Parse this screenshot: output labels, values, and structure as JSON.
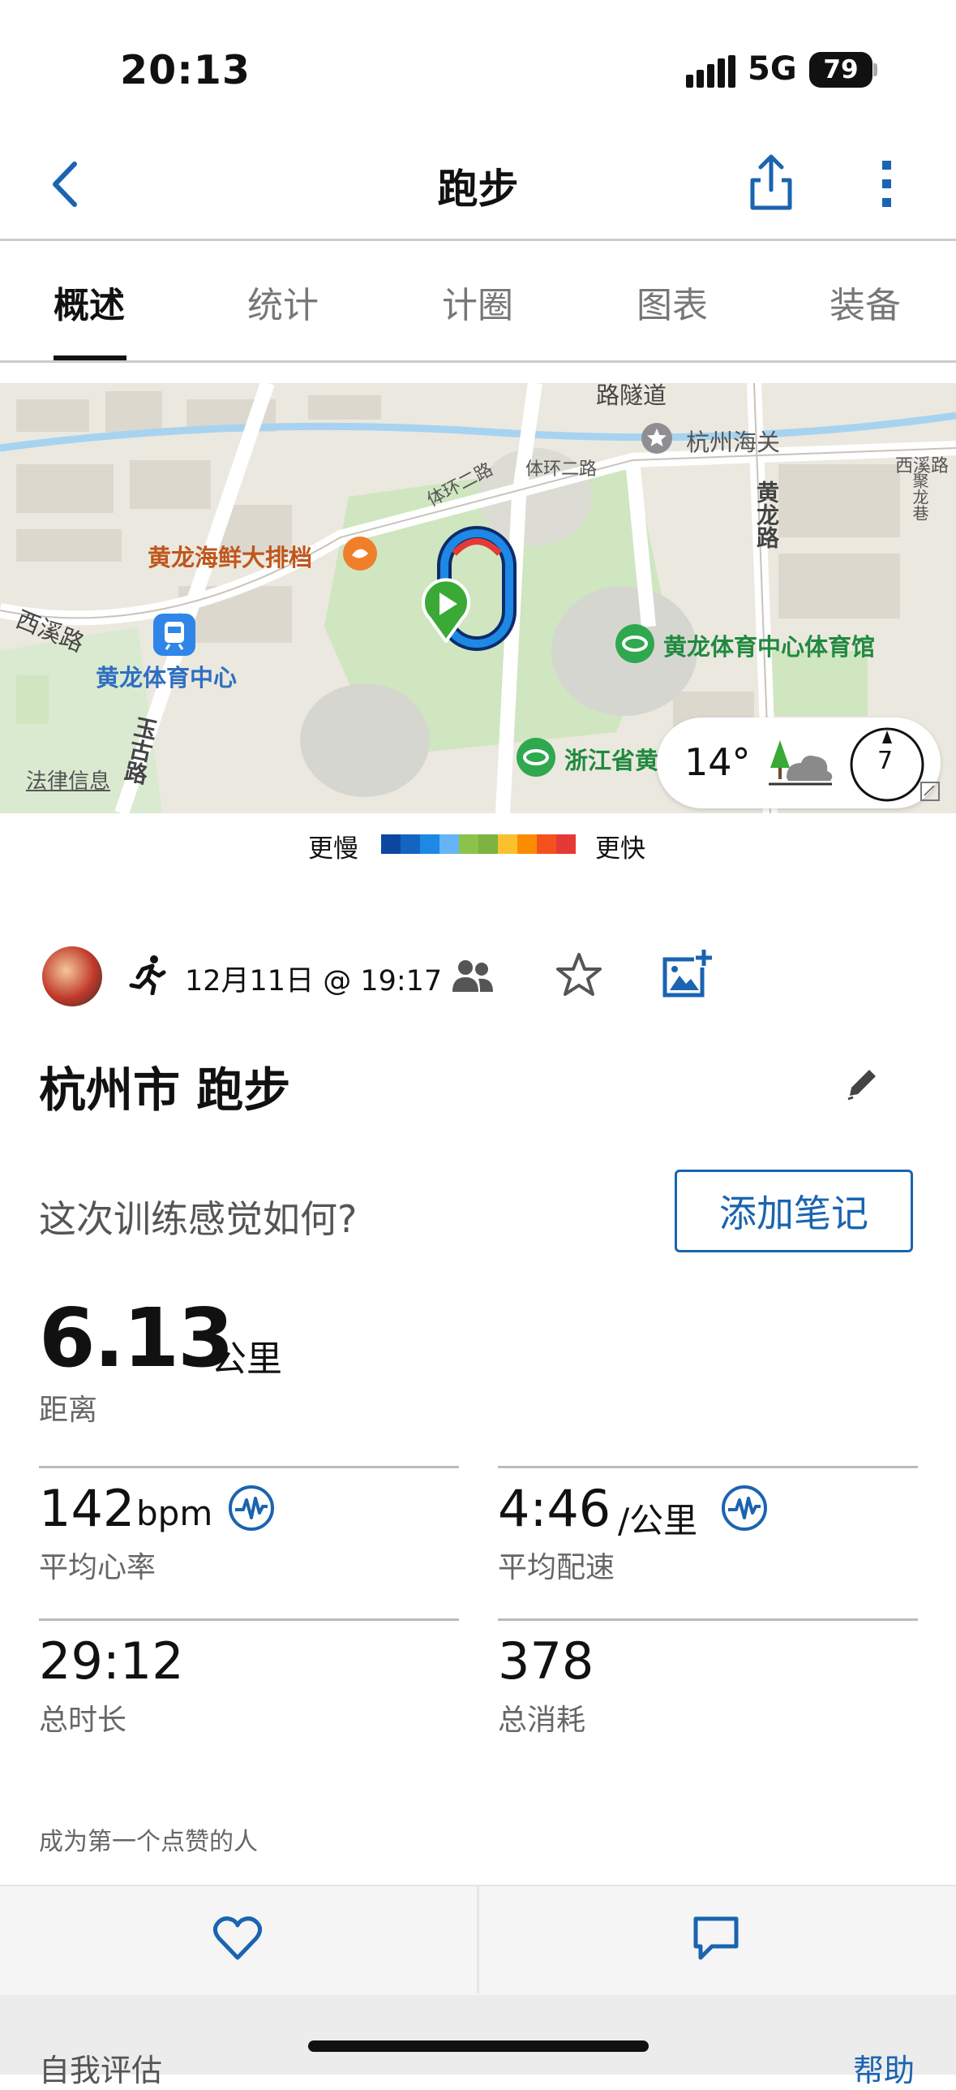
{
  "status_bar": {
    "time": "20:13",
    "network": "5G",
    "battery": "79"
  },
  "nav": {
    "title": "跑步"
  },
  "tabs": [
    {
      "label": "概述",
      "active": true
    },
    {
      "label": "统计",
      "active": false
    },
    {
      "label": "计圈",
      "active": false
    },
    {
      "label": "图表",
      "active": false
    },
    {
      "label": "装备",
      "active": false
    }
  ],
  "map": {
    "labels": {
      "road_top": "路隧道",
      "customs": "杭州海关",
      "road_xixi_right": "西溪路",
      "road_tihuan1": "体环二路",
      "road_tihuan2": "体环二路",
      "road_juyuan": "聚龙巷",
      "road_huanglong": "黄龙路",
      "restaurant": "黄龙海鲜大排档",
      "road_xixi_left": "西溪路",
      "metro_station": "黄龙体育中心",
      "road_wangu": "玉古路",
      "gym": "黄龙体育中心体育馆",
      "province": "浙江省黄",
      "legal": "法律信息"
    },
    "weather": {
      "temperature": "14°",
      "wind": "7"
    }
  },
  "legend": {
    "slower": "更慢",
    "faster": "更快",
    "colors": [
      "#0d47a1",
      "#1565c0",
      "#1e88e5",
      "#64b5f6",
      "#8bc34a",
      "#7cb342",
      "#fbc02d",
      "#fb8c00",
      "#f4511e",
      "#e53935"
    ]
  },
  "activity": {
    "date": "12月11日 @ 19:17",
    "title": "杭州市 跑步",
    "feel_question": "这次训练感觉如何?",
    "add_note": "添加笔记",
    "distance": {
      "value": "6.13",
      "unit": "公里",
      "label": "距离"
    },
    "heart_rate": {
      "value": "142",
      "unit": "bpm",
      "label": "平均心率"
    },
    "pace": {
      "value": "4:46",
      "unit": "/公里",
      "label": "平均配速"
    },
    "duration": {
      "value": "29:12",
      "label": "总时长"
    },
    "calories": {
      "value": "378",
      "label": "总消耗"
    }
  },
  "social": {
    "likes_text": "成为第一个点赞的人"
  },
  "bottom": {
    "self_eval": "自我评估",
    "help": "帮助"
  },
  "colors": {
    "accent": "#1a64b0",
    "route_green": "#3aa935"
  }
}
